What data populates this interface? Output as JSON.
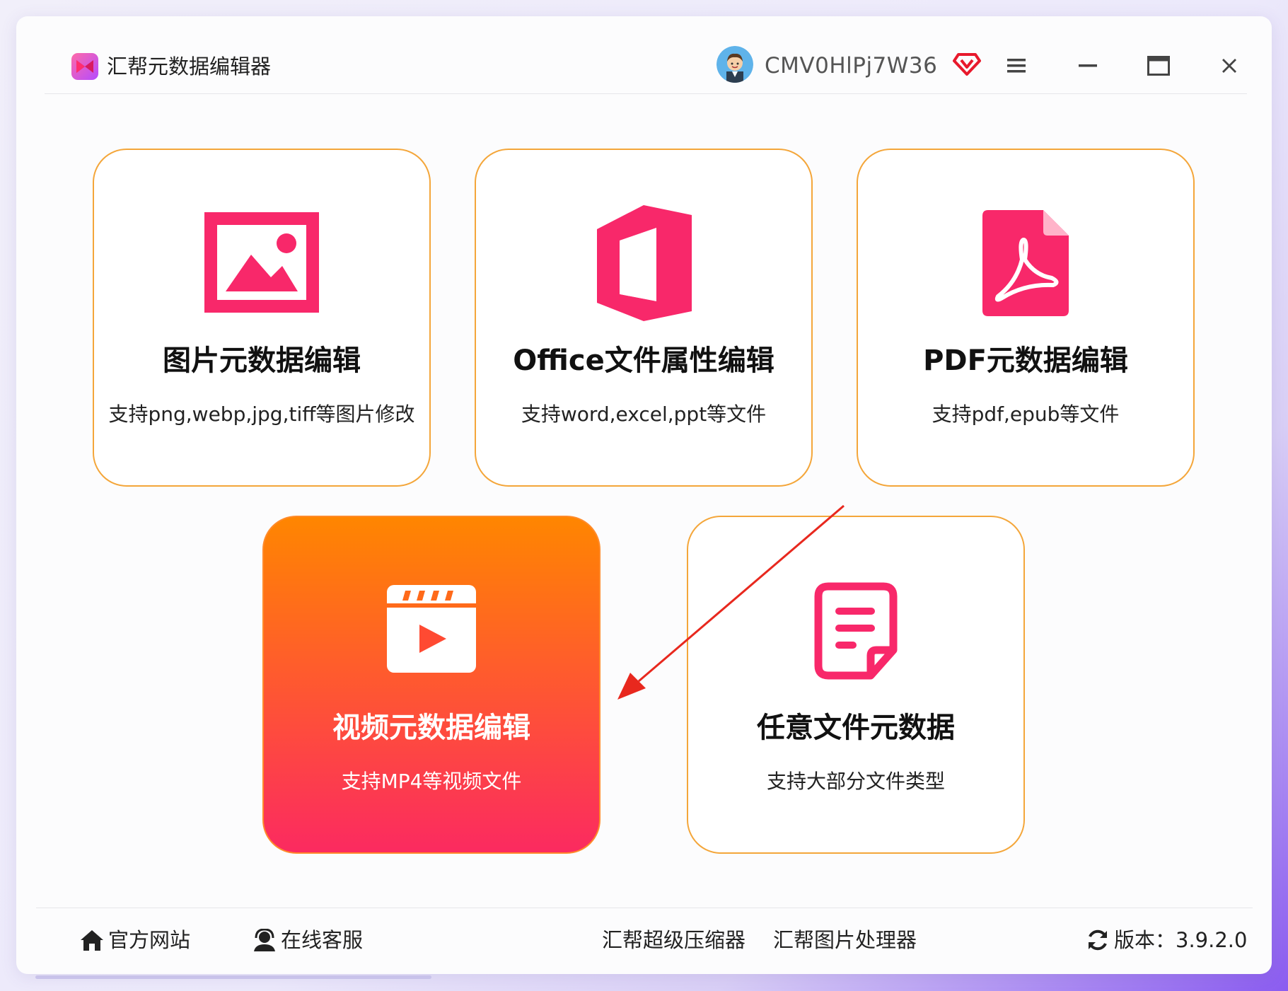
{
  "app": {
    "title": "汇帮元数据编辑器"
  },
  "user": {
    "name": "CMV0HlPj7W36"
  },
  "cards": [
    {
      "title": "图片元数据编辑",
      "desc": "支持png,webp,jpg,tiff等图片修改",
      "icon": "image-icon"
    },
    {
      "title": "Office文件属性编辑",
      "desc": "支持word,excel,ppt等文件",
      "icon": "office-icon"
    },
    {
      "title": "PDF元数据编辑",
      "desc": "支持pdf,epub等文件",
      "icon": "pdf-icon"
    },
    {
      "title": "视频元数据编辑",
      "desc": "支持MP4等视频文件",
      "icon": "video-icon"
    },
    {
      "title": "任意文件元数据",
      "desc": "支持大部分文件类型",
      "icon": "document-icon"
    }
  ],
  "footer": {
    "website": "官方网站",
    "support": "在线客服",
    "compressor": "汇帮超级压缩器",
    "image_tool": "汇帮图片处理器",
    "version": "版本：3.9.2.0"
  },
  "colors": {
    "accent_pink": "#f8286a",
    "card_border": "#f4a63a",
    "active_top": "#ff8600",
    "active_bottom": "#fb2a60",
    "arrow": "#e8281e"
  }
}
